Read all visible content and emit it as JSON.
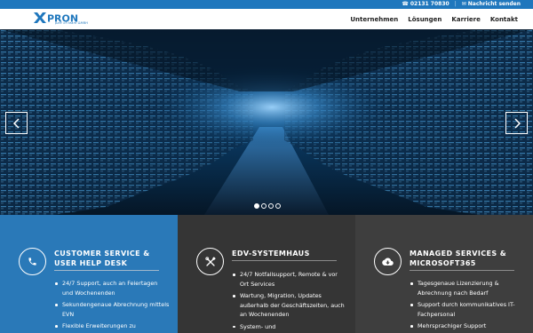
{
  "topbar": {
    "phone": "02131 70830",
    "separator": "|",
    "message": "Nachricht senden",
    "phone_icon": "phone-icon",
    "mail_icon": "mail-icon"
  },
  "header": {
    "logo_text": "PRON",
    "logo_sub": "part of team GMBH",
    "nav": [
      "Unternehmen",
      "Lösungen",
      "Karriere",
      "Kontakt"
    ]
  },
  "hero": {
    "prev_icon": "chevron-left-icon",
    "next_icon": "chevron-right-icon",
    "slides": 4,
    "active_slide": 1
  },
  "services": [
    {
      "title": "CUSTOMER SERVICE & USER HELP DESK",
      "icon": "phone-icon",
      "bg": "#2a79b8",
      "items": [
        "24/7 Support, auch an Feiertagen und Wochenenden",
        "Sekundengenaue Abrechnung mittels EVN",
        "Flexible Erweiterungen zu"
      ]
    },
    {
      "title": "EDV-SYSTEMHAUS",
      "icon": "tools-icon",
      "bg": "#353535",
      "items": [
        "24/7 Notfallsupport, Remote & vor Ort Services",
        "Wartung, Migration, Updates außerhalb der Geschäftszeiten, auch an Wochenenden",
        "System- und"
      ]
    },
    {
      "title": "MANAGED SERVICES & MICROSOFT365",
      "icon": "cloud-download-icon",
      "bg": "#3e3e3e",
      "items": [
        "Tagesgenaue Lizenzierung & Abrechnung nach Bedarf",
        "Support durch kommunikatives IT-Fachpersonal",
        "Mehrsprachiger Support"
      ]
    }
  ],
  "colors": {
    "brand_blue": "#1f77bd",
    "service_blue": "#2a79b8",
    "dark_1": "#353535",
    "dark_2": "#3e3e3e"
  }
}
